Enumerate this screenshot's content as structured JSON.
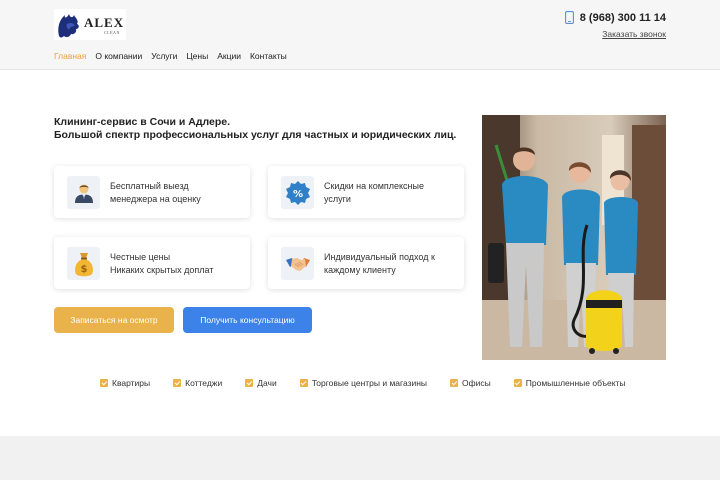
{
  "brand": {
    "name": "ALEX",
    "sub": "CLEAN"
  },
  "nav": {
    "items": [
      "Главная",
      "О компании",
      "Услуги",
      "Цены",
      "Акции",
      "Контакты"
    ]
  },
  "contact": {
    "phone": "8 (968) 300 11 14",
    "callback": "Заказать звонок"
  },
  "hero": {
    "line1": "Клининг-сервис в Сочи и Адлере.",
    "line2": "Большой спектр профессиональных услуг для частных и юридических лиц."
  },
  "features": [
    {
      "icon": "manager-icon",
      "line1": "Бесплатный выезд",
      "line2": "менеджера на оценку"
    },
    {
      "icon": "discount-icon",
      "line1": "Скидки на комплексные",
      "line2": "услуги"
    },
    {
      "icon": "money-bag-icon",
      "line1": "Честные цены",
      "line2": "Никаких скрытых доплат"
    },
    {
      "icon": "handshake-icon",
      "line1": "Индивидуальный подход к",
      "line2": "каждому клиенту"
    }
  ],
  "buttons": {
    "primary": "Записаться на осмотр",
    "secondary": "Получить консультацию"
  },
  "categories": [
    "Квартиры",
    "Коттеджи",
    "Дачи",
    "Торговые центры и магазины",
    "Офисы",
    "Промышленные объекты"
  ],
  "colors": {
    "accent": "#eab24a",
    "blue": "#3c82e8",
    "nav_active": "#e9a23b"
  }
}
